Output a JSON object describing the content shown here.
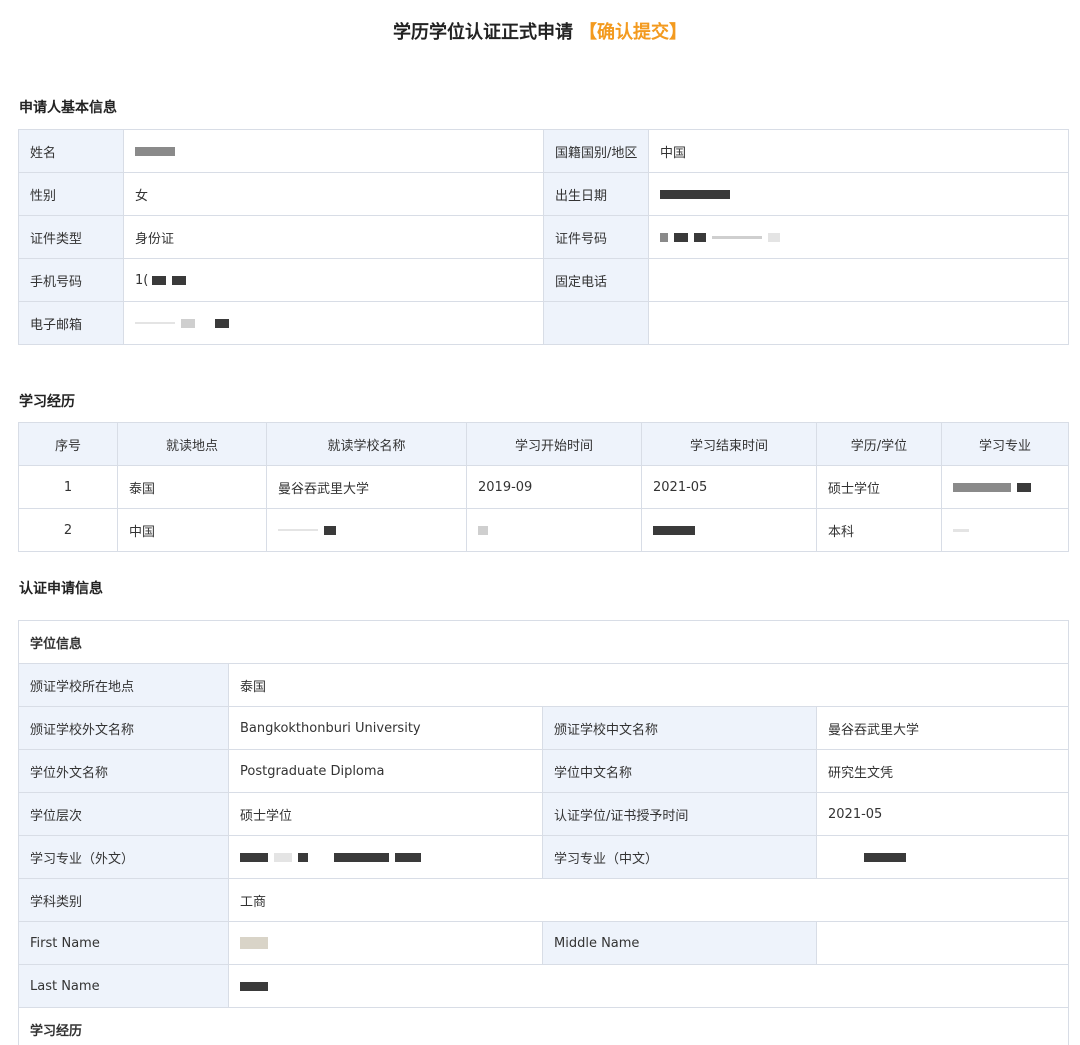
{
  "header": {
    "title": "学历学位认证正式申请",
    "tag": "【确认提交】"
  },
  "applicant": {
    "section_title": "申请人基本信息",
    "rows": [
      {
        "l1": "姓名",
        "v1": "",
        "l2": "国籍国别/地区",
        "v2": "中国"
      },
      {
        "l1": "性别",
        "v1": "女",
        "l2": "出生日期",
        "v2": ""
      },
      {
        "l1": "证件类型",
        "v1": "身份证",
        "l2": "证件号码",
        "v2": ""
      },
      {
        "l1": "手机号码",
        "v1": "1(",
        "l2": "固定电话",
        "v2": ""
      },
      {
        "l1": "电子邮箱",
        "v1": "",
        "l2": "",
        "v2": ""
      }
    ]
  },
  "education": {
    "section_title": "学习经历",
    "headers": [
      "序号",
      "就读地点",
      "就读学校名称",
      "学习开始时间",
      "学习结束时间",
      "学历/学位",
      "学习专业"
    ],
    "rows": [
      {
        "no": "1",
        "place": "泰国",
        "school": "曼谷吞武里大学",
        "start": "2019-09",
        "end": "2021-05",
        "degree": "硕士学位",
        "major": ""
      },
      {
        "no": "2",
        "place": "中国",
        "school": "",
        "start": "",
        "end": "",
        "degree": "本科",
        "major": ""
      }
    ]
  },
  "cert": {
    "section_title": "认证申请信息",
    "degree_info": "学位信息",
    "location_label": "颁证学校所在地点",
    "location_value": "泰国",
    "foreign_school_label": "颁证学校外文名称",
    "foreign_school_value": "Bangkokthonburi University",
    "cn_school_label": "颁证学校中文名称",
    "cn_school_value": "曼谷吞武里大学",
    "foreign_degree_label": "学位外文名称",
    "foreign_degree_value": "Postgraduate Diploma",
    "cn_degree_label": "学位中文名称",
    "cn_degree_value": "研究生文凭",
    "level_label": "学位层次",
    "level_value": "硕士学位",
    "grant_time_label": "认证学位/证书授予时间",
    "grant_time_value": "2021-05",
    "major_foreign_label": "学习专业（外文）",
    "major_cn_label": "学习专业（中文）",
    "discipline_label": "学科类别",
    "discipline_value": "工商",
    "first_name_label": "First Name",
    "middle_name_label": "Middle Name",
    "last_name_label": "Last Name",
    "study_history_label": "学习经历"
  },
  "colors": {
    "accent": "#f39a1f",
    "label_bg": "#eef3fb",
    "border": "#d8dde6"
  }
}
